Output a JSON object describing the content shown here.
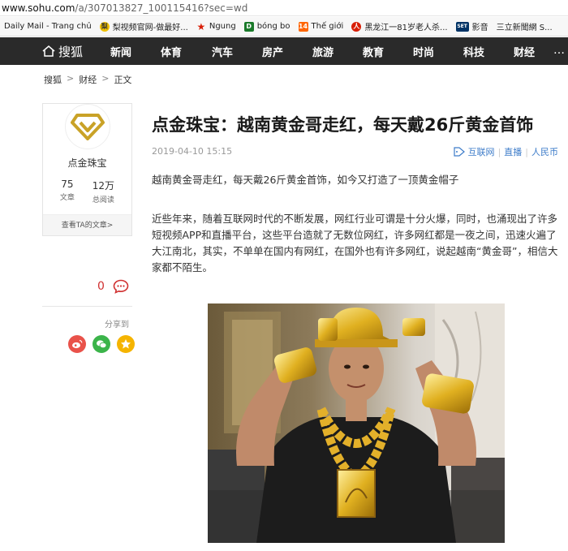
{
  "browser": {
    "url_host": "www.sohu.com",
    "url_path": "/a/307013827_100115416?sec=wd",
    "bookmarks": [
      {
        "label": "Daily Mail - Trang chủ",
        "icon": "none"
      },
      {
        "label": "梨视频官网-做最好...",
        "icon": "pear-icon",
        "color": "#f0c000"
      },
      {
        "label": "Ngung",
        "icon": "star-icon",
        "color": "#d81e06"
      },
      {
        "label": "bóng bo",
        "icon": "d-icon",
        "color": "#1a7a2a"
      },
      {
        "label": "Thế giới",
        "icon": "news-icon",
        "color": "#ff6600"
      },
      {
        "label": "黑龙江一81岁老人杀...",
        "icon": "red-logo-icon",
        "color": "#d81e06"
      },
      {
        "label": "影音",
        "icon": "set-icon",
        "color": "#003366"
      },
      {
        "label": "三立新聞網 S...",
        "icon": "none"
      }
    ]
  },
  "nav": {
    "logo_text": "搜狐",
    "items": [
      "新闻",
      "体育",
      "汽车",
      "房产",
      "旅游",
      "教育",
      "时尚",
      "科技",
      "财经"
    ],
    "more": "…"
  },
  "breadcrumb": [
    "搜狐",
    "财经",
    "正文"
  ],
  "author_card": {
    "name": "点金珠宝",
    "articles_count": "75",
    "articles_label": "文章",
    "views_count": "12万",
    "views_label": "总阅读",
    "link": "查看TA的文章>"
  },
  "comments": {
    "count": "0"
  },
  "share": {
    "label": "分享到"
  },
  "article": {
    "title": "点金珠宝：越南黄金哥走红，每天戴26斤黄金首饰",
    "date": "2019-04-10 15:15",
    "tags": [
      "互联网",
      "直播",
      "人民币"
    ],
    "paragraph1": "越南黄金哥走红，每天戴26斤黄金首饰，如今又打造了一顶黄金帽子",
    "paragraph2": "近些年来，随着互联网时代的不断发展，网红行业可谓是十分火爆，同时，也涌现出了许多短视频APP和直播平台，这些平台造就了无数位网红，许多网红都是一夜之间，迅速火遍了大江南北，其实，不单单在国内有网红，在国外也有许多网红，说起越南“黄金哥”，相信大家都不陌生。"
  },
  "colors": {
    "nav_bg": "#2a2a2a",
    "accent_link": "#3d7cc9",
    "gold": "#d4a017",
    "comment_red": "#d03030"
  }
}
